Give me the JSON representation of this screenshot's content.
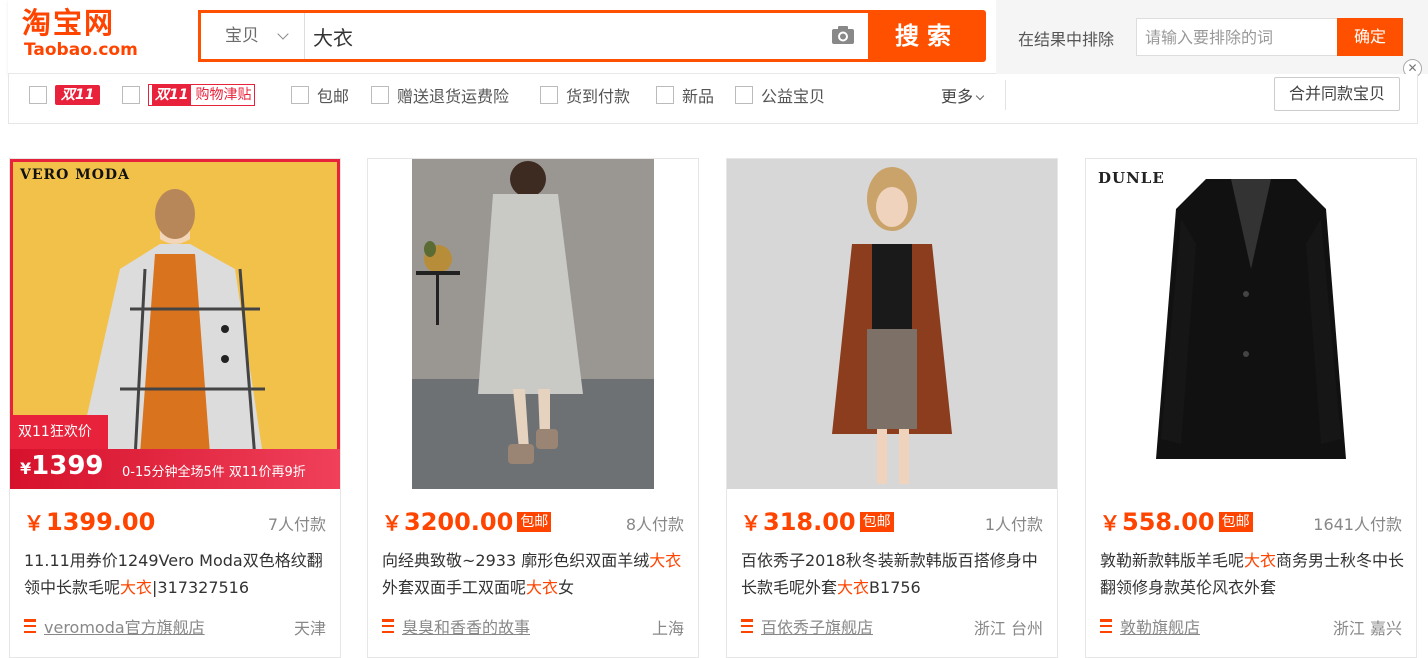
{
  "logo": {
    "cn": "淘宝网",
    "en": "Taobao.com"
  },
  "search": {
    "category": "宝贝",
    "query": "大衣",
    "button": "搜索"
  },
  "exclude": {
    "label": "在结果中排除",
    "placeholder": "请输入要排除的词",
    "confirm": "确定"
  },
  "filters": {
    "d11_badge": "双11",
    "jintie_d11": "双11",
    "jintie_text": "购物津贴",
    "items": [
      "包邮",
      "赠送退货运费险",
      "货到付款",
      "新品",
      "公益宝贝"
    ],
    "more": "更多",
    "merge": "合并同款宝贝"
  },
  "products": [
    {
      "brand": "VERO MODA",
      "promo_label": "双11狂欢价",
      "promo_price_yen": "¥",
      "promo_price": "1399",
      "promo_note": "0-15分钟全场5件 双11价再9折",
      "price": "1399.00",
      "baoyou": "",
      "sales": "7人付款",
      "title_a": "11.11用券价1249Vero Moda双色格纹翻领中长款毛呢",
      "title_hl": "大衣",
      "title_b": "|317327516",
      "shop": "veromoda官方旗舰店",
      "location": "天津"
    },
    {
      "price": "3200.00",
      "baoyou": "包邮",
      "sales": "8人付款",
      "title_a": "向经典致敬~2933 廓形色织双面羊绒",
      "title_hl": "大衣",
      "title_b": "外套双面手工双面呢",
      "title_hl2": "大衣",
      "title_c": "女",
      "shop": "臭臭和香香的故事",
      "location": "上海"
    },
    {
      "price": "318.00",
      "baoyou": "包邮",
      "sales": "1人付款",
      "title_a": "百依秀子2018秋冬装新款韩版百搭修身中长款毛呢外套",
      "title_hl": "大衣",
      "title_b": "B1756",
      "shop": "百依秀子旗舰店",
      "location": "浙江 台州"
    },
    {
      "brand": "DUNLE",
      "price": "558.00",
      "baoyou": "包邮",
      "sales": "1641人付款",
      "title_a": "敦勒新款韩版羊毛呢",
      "title_hl": "大衣",
      "title_b": "商务男士秋冬中长翻领修身款英伦风衣外套",
      "shop": "敦勒旗舰店",
      "location": "浙江 嘉兴"
    }
  ],
  "currency": "￥",
  "colors": {
    "accent": "#ff5000",
    "price": "#ff4400",
    "promo": "#e8223a"
  }
}
